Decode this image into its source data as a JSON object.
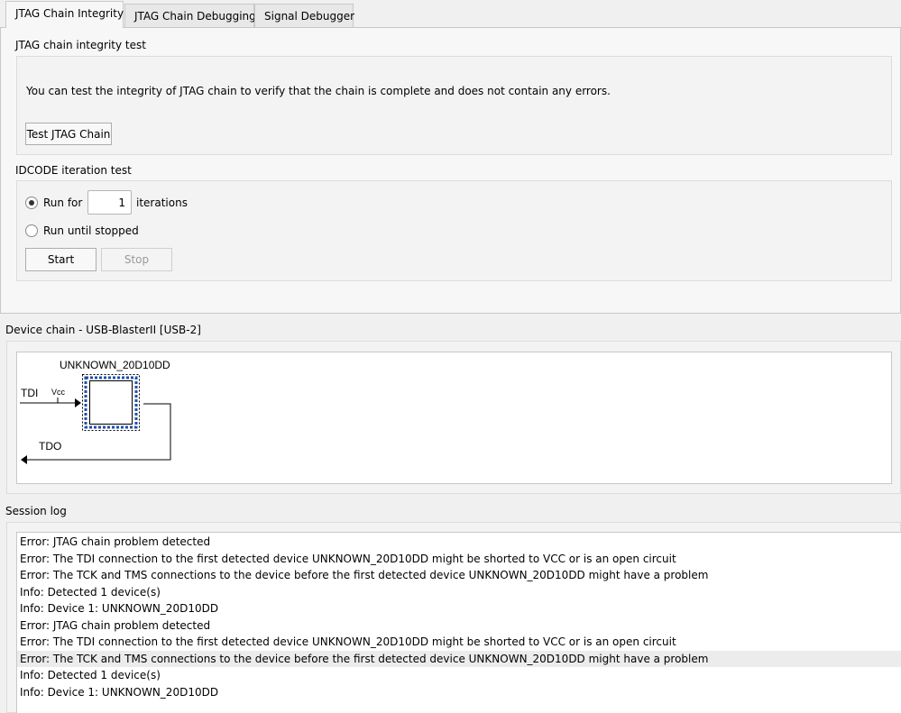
{
  "tabs": [
    {
      "label": "JTAG Chain Integrity",
      "active": true
    },
    {
      "label": "JTAG Chain Debugging"
    },
    {
      "label": "Signal Debugger"
    }
  ],
  "integrity": {
    "title": "JTAG chain integrity test",
    "description": "You can test the integrity of JTAG chain to verify that the chain is complete and does not contain any errors.",
    "test_button": "Test JTAG Chain"
  },
  "idcode": {
    "title": "IDCODE iteration test",
    "run_for_label": "Run for",
    "iterations_value": "1",
    "iterations_label": "iterations",
    "run_until_label": "Run until stopped",
    "start_label": "Start",
    "stop_label": "Stop",
    "selected": "run_for"
  },
  "device_chain": {
    "title": "Device chain - USB-BlasterII [USB-2]",
    "device_name": "UNKNOWN_20D10DD",
    "tdi": "TDI",
    "tdo": "TDO",
    "vcc": "Vcc",
    "accent": "#1f4fa8"
  },
  "session_log": {
    "title": "Session log",
    "lines": [
      "Error: JTAG chain problem detected",
      "Error: The TDI connection to the first detected device UNKNOWN_20D10DD might be shorted to VCC or is an open circuit",
      "Error: The TCK and TMS connections to the device before the first detected device UNKNOWN_20D10DD might have a problem",
      "Info: Detected 1 device(s)",
      "Info: Device 1: UNKNOWN_20D10DD",
      "Error: JTAG chain problem detected",
      "Error: The TDI connection to the first detected device UNKNOWN_20D10DD might be shorted to VCC or is an open circuit",
      "Error: The TCK and TMS connections to the device before the first detected device UNKNOWN_20D10DD might have a problem",
      "Info: Detected 1 device(s)",
      "Info: Device 1: UNKNOWN_20D10DD"
    ],
    "selected_index": 7
  }
}
